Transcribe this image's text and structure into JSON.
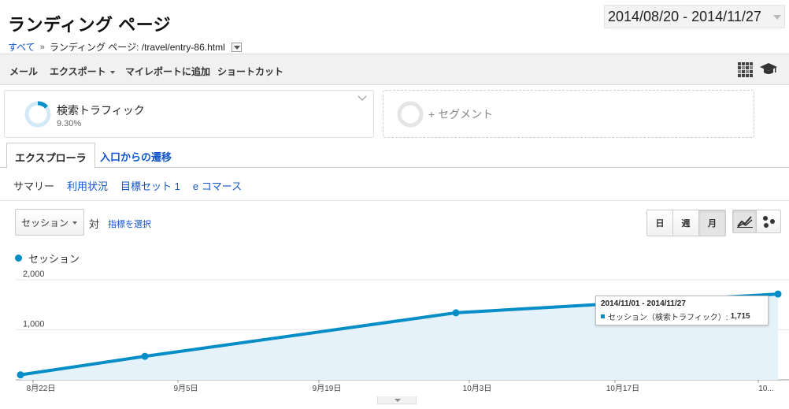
{
  "page": {
    "title": "ランディング ページ"
  },
  "date_range": {
    "label": "2014/08/20 - 2014/11/27"
  },
  "breadcrumb": {
    "root": "すべて",
    "separator": "»",
    "current": "ランディング ページ: /travel/entry-86.html"
  },
  "toolbar": {
    "items": [
      "メール",
      "エクスポート",
      "マイレポートに追加",
      "ショートカット"
    ],
    "icons": [
      "grid-icon",
      "graduation-cap-icon"
    ]
  },
  "segments": {
    "active": {
      "name": "検索トラフィック",
      "percent": "9.30%"
    },
    "add_label": "+ セグメント"
  },
  "tabs": [
    "エクスプローラ",
    "入口からの遷移"
  ],
  "subnav": [
    "サマリー",
    "利用状況",
    "目標セット 1",
    "e コマース"
  ],
  "controls": {
    "metric": "セッション",
    "vs": "対",
    "pick_metric": "指標を選択",
    "periods": [
      "日",
      "週",
      "月"
    ],
    "active_period": "月",
    "views": [
      "line-chart-icon",
      "motion-chart-icon"
    ]
  },
  "legend": {
    "series": "セッション",
    "color": "#058dc7"
  },
  "tooltip": {
    "title": "2014/11/01 - 2014/11/27",
    "series_label": "セッション（検索トラフィック）:",
    "value": "1,715"
  },
  "chart_data": {
    "type": "area",
    "x": [
      "2014-08-20",
      "2014-09-01",
      "2014-10-01",
      "2014-11-01"
    ],
    "series": [
      {
        "name": "セッション",
        "values": [
          100,
          470,
          1340,
          1715
        ]
      }
    ],
    "y_ticks": [
      "2,000",
      "1,000"
    ],
    "ylim": [
      0,
      2000
    ],
    "x_tick_labels": [
      "8月22日",
      "9月5日",
      "9月19日",
      "10月3日",
      "10月17日",
      "10..."
    ],
    "grid": true,
    "color": "#058dc7"
  }
}
